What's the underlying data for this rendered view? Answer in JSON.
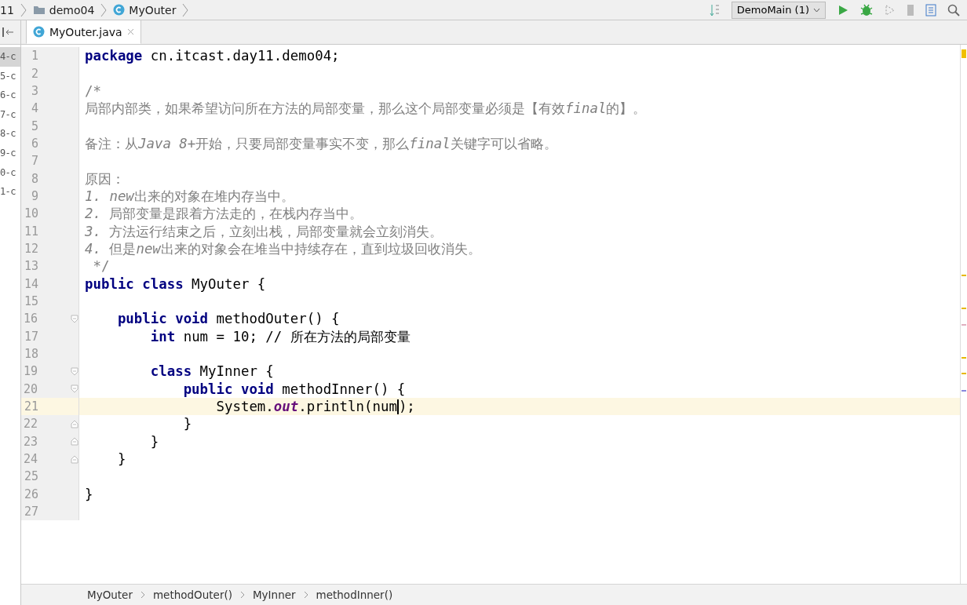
{
  "nav_bar": {
    "crumbs": [
      "11",
      "demo04",
      "MyOuter"
    ],
    "run_config": "DemoMain (1)"
  },
  "project_panel": {
    "items": [
      {
        "label": "4-c",
        "selected": true
      },
      {
        "label": "5-c",
        "selected": false
      },
      {
        "label": "6-c",
        "selected": false
      },
      {
        "label": "7-c",
        "selected": false
      },
      {
        "label": "8-c",
        "selected": false
      },
      {
        "label": "9-c",
        "selected": false
      },
      {
        "label": "0-c",
        "selected": false
      },
      {
        "label": "1-c",
        "selected": false
      }
    ]
  },
  "tabs": [
    {
      "label": "MyOuter.java",
      "selected": true
    }
  ],
  "editor": {
    "lines": [
      {
        "number": "1",
        "selected": false,
        "kind": "code",
        "text": "**package** cn.itcast.day11.demo04;"
      },
      {
        "number": "2",
        "selected": false
      },
      {
        "number": "3",
        "selected": false,
        "kind": "comment",
        "text": "/*"
      },
      {
        "number": "4",
        "selected": false,
        "kind": "comment",
        "segments": [
          {
            "text": "局部内部类，如果希望访问所在方法的局部变量，那么这个局部变量必须是【有效",
            "italic": false
          },
          {
            "text": "final",
            "italic": true
          },
          {
            "text": "的】。",
            "italic": false
          }
        ]
      },
      {
        "number": "5",
        "selected": false
      },
      {
        "number": "6",
        "selected": false,
        "kind": "comment",
        "segments": [
          {
            "text": "备注：从",
            "italic": false
          },
          {
            "text": "Java 8+",
            "italic": true
          },
          {
            "text": "开始，只要局部变量事实不变，那么",
            "italic": false
          },
          {
            "text": "final",
            "italic": true
          },
          {
            "text": "关键字可以省略。",
            "italic": false
          }
        ]
      },
      {
        "number": "7",
        "selected": false
      },
      {
        "number": "8",
        "selected": false,
        "kind": "comment",
        "text": "原因："
      },
      {
        "number": "9",
        "selected": false,
        "kind": "comment",
        "segments": [
          {
            "text": "1. new",
            "italic": true
          },
          {
            "text": "出来的对象在堆内存当中。",
            "italic": false
          }
        ]
      },
      {
        "number": "10",
        "selected": false,
        "kind": "comment",
        "text": "*2.* 局部变量是跟着方法走的，在栈内存当中。"
      },
      {
        "number": "11",
        "selected": false,
        "kind": "comment",
        "text": "*3.* 方法运行结束之后，立刻出栈，局部变量就会立刻消失。"
      },
      {
        "number": "12",
        "selected": false,
        "kind": "comment",
        "segments": [
          {
            "text": "4. ",
            "italic": true
          },
          {
            "text": "但是",
            "italic": false
          },
          {
            "text": "new",
            "italic": true
          },
          {
            "text": "出来的对象会在堆当中持续存在，直到垃圾回收消失。",
            "italic": false
          }
        ]
      },
      {
        "number": "13",
        "selected": false,
        "kind": "comment",
        "text": " */"
      },
      {
        "number": "14",
        "selected": false,
        "kind": "code",
        "text": "**public class** MyOuter {"
      },
      {
        "number": "15",
        "selected": false
      },
      {
        "number": "16",
        "selected": false,
        "fold_start": true,
        "kind": "code",
        "text": "    **public void** methodOuter() {"
      },
      {
        "number": "17",
        "selected": false,
        "kind": "code",
        "text": "        **int** num = 10; // 所在方法的局部变量"
      },
      {
        "number": "18",
        "selected": false
      },
      {
        "number": "19",
        "selected": false,
        "fold_start": true,
        "kind": "code",
        "text": "        **class** MyInner {"
      },
      {
        "number": "20",
        "selected": false,
        "fold_start": true,
        "kind": "code",
        "text": "            **public void** methodInner() {"
      },
      {
        "number": "21",
        "selected": true,
        "kind": "code",
        "text": "                System.*out*.println(num",
        "after_caret": ");"
      },
      {
        "number": "22",
        "selected": false,
        "fold_end": true,
        "kind": "code",
        "text": "            }"
      },
      {
        "number": "23",
        "selected": false,
        "fold_end": true,
        "kind": "code",
        "text": "        }"
      },
      {
        "number": "24",
        "selected": false,
        "fold_end": true,
        "kind": "code",
        "text": "    }"
      },
      {
        "number": "25",
        "selected": false
      },
      {
        "number": "26",
        "selected": false,
        "kind": "code",
        "text": "}"
      },
      {
        "number": "27",
        "selected": false
      }
    ]
  },
  "breadcrumbs": [
    "MyOuter",
    "methodOuter()",
    "MyInner",
    "methodInner()"
  ]
}
